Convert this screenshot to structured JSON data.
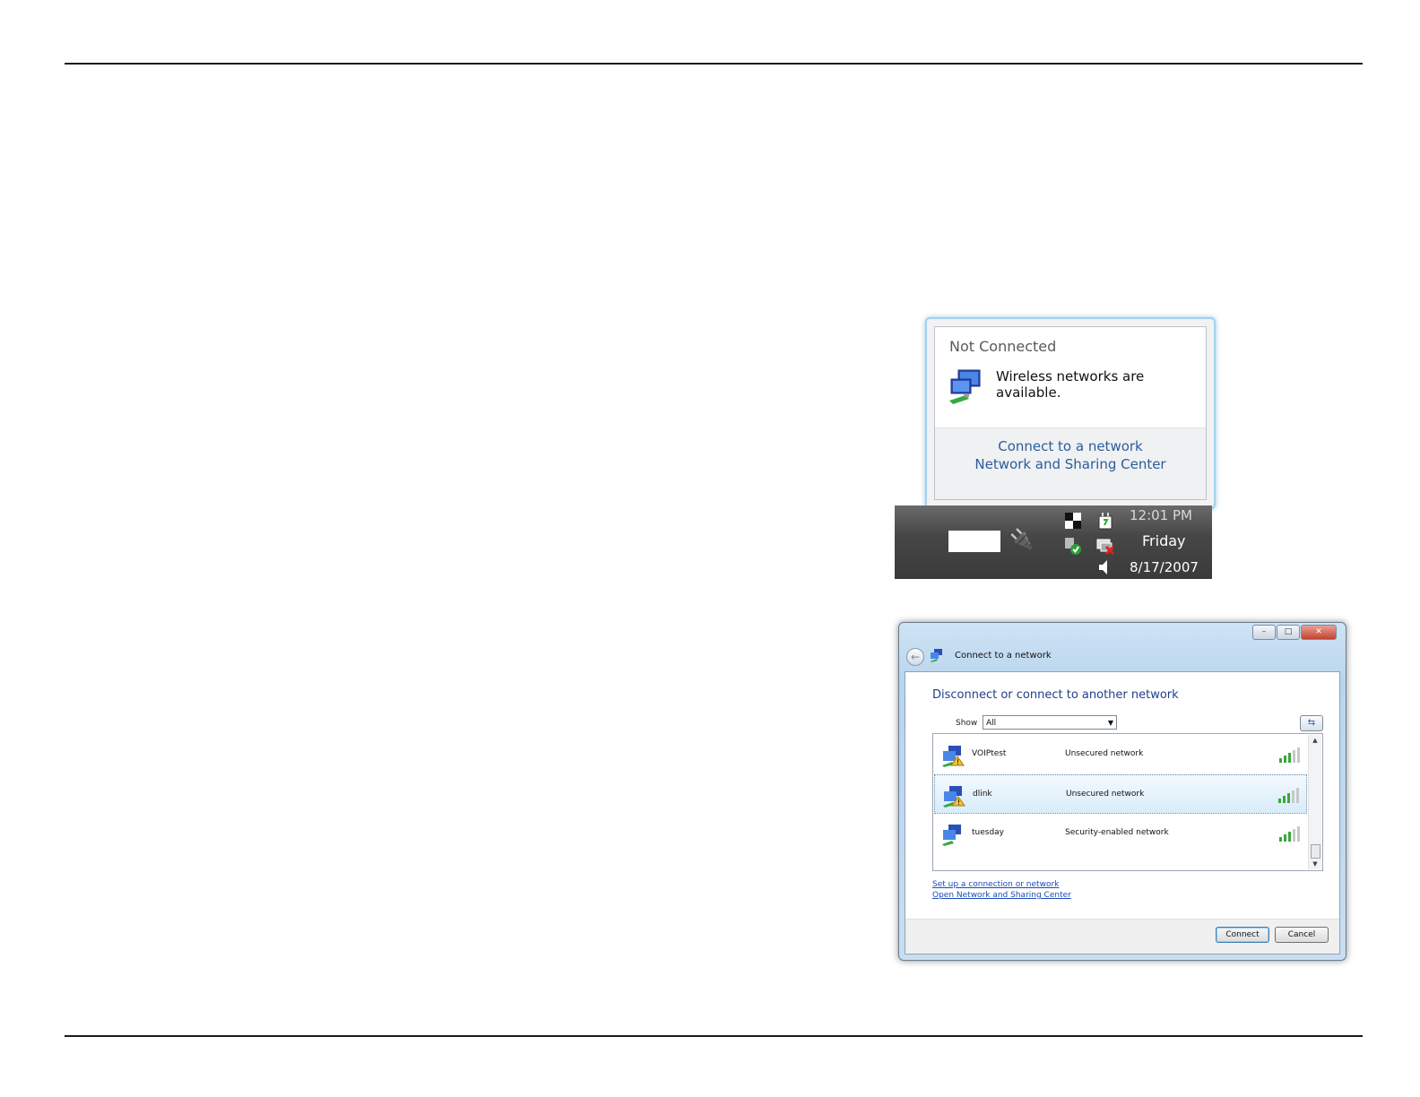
{
  "tray": {
    "balloon": {
      "title": "Not Connected",
      "message": "Wireless networks are available.",
      "links": [
        "Connect to a network",
        "Network and Sharing Center"
      ]
    },
    "clock": {
      "time": "12:01 PM",
      "day": "Friday",
      "date": "8/17/2007"
    }
  },
  "dialog": {
    "title": "Connect to a network",
    "heading": "Disconnect or connect to another network",
    "show_label": "Show",
    "show_value": "All",
    "networks": [
      {
        "name": "VOIPtest",
        "security": "Unsecured network",
        "selected": false
      },
      {
        "name": "dlink",
        "security": "Unsecured network",
        "selected": true
      },
      {
        "name": "tuesday",
        "security": "Security-enabled network",
        "selected": false
      }
    ],
    "links": {
      "setup": "Set up a connection or network",
      "sharing_center": "Open Network and Sharing Center"
    },
    "buttons": {
      "connect": "Connect",
      "cancel": "Cancel"
    }
  }
}
